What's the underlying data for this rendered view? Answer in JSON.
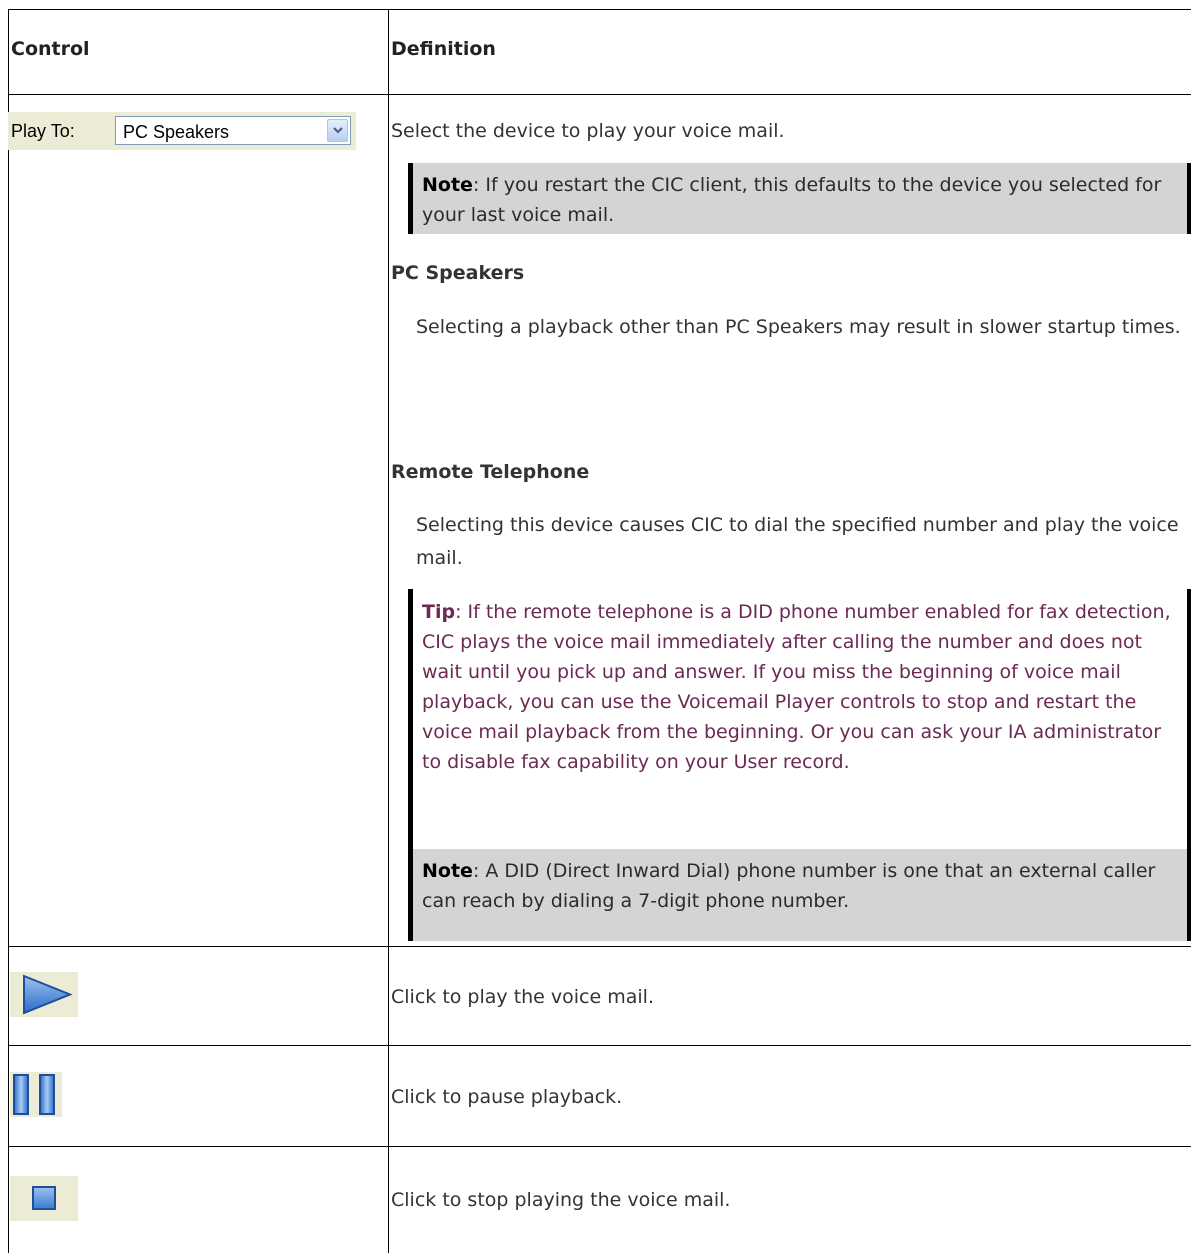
{
  "table": {
    "header": {
      "control": "Control",
      "definition": "Definition"
    },
    "play_to": {
      "label": "Play To:",
      "selected": "PC Speakers",
      "description": "Select the device to play your voice mail.",
      "note_bold": "Note",
      "note_text": ": If you restart the CIC client, this defaults to the device you selected for your last voice mail.",
      "pc_speakers_heading": "PC Speakers",
      "pc_speakers_text": "Selecting a playback other than PC Speakers may result in slower startup times.",
      "remote_heading": "Remote Telephone",
      "remote_text": "Selecting this device causes CIC to dial the specified number and play the voice mail.",
      "tip_bold": "Tip",
      "tip_text": ": If the remote telephone is a DID phone number enabled for fax detection, CIC plays the voice mail immediately after calling the number and does not wait until you pick up and answer. If you miss the beginning of voice mail playback, you can use the Voicemail Player controls to stop and restart the voice mail playback from the beginning. Or you can ask your IA administrator to disable fax capability on your User record.",
      "note2_bold": "Note",
      "note2_text": ": A DID (Direct Inward Dial) phone number is one that an external caller can reach by dialing a 7-digit phone number."
    },
    "play": {
      "icon": "play-icon",
      "description": "Click to play the voice mail."
    },
    "pause": {
      "icon": "pause-icon",
      "description": "Click to pause playback."
    },
    "stop": {
      "icon": "stop-icon",
      "description": "Click to stop playing the voice mail."
    }
  }
}
